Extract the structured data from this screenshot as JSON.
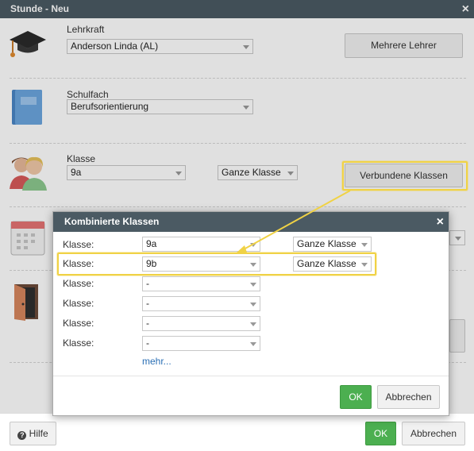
{
  "dialog": {
    "title": "Stunde - Neu",
    "close": "×",
    "teacher": {
      "label": "Lehrkraft",
      "value": "Anderson Linda (AL)",
      "button": "Mehrere Lehrer"
    },
    "subject": {
      "label": "Schulfach",
      "value": "Berufsorientierung"
    },
    "class": {
      "label": "Klasse",
      "value": "9a",
      "scope": "Ganze Klasse",
      "button": "Verbundene Klassen"
    },
    "help_button": "Hilfe",
    "ok_button": "OK",
    "cancel_button": "Abbrechen"
  },
  "modal": {
    "title": "Kombinierte Klassen",
    "close": "×",
    "rows": [
      {
        "label": "Klasse:",
        "value": "9a",
        "scope": "Ganze Klasse"
      },
      {
        "label": "Klasse:",
        "value": "9b",
        "scope": "Ganze Klasse"
      },
      {
        "label": "Klasse:",
        "value": "-"
      },
      {
        "label": "Klasse:",
        "value": "-"
      },
      {
        "label": "Klasse:",
        "value": "-"
      },
      {
        "label": "Klasse:",
        "value": "-"
      }
    ],
    "more_link": "mehr...",
    "ok_button": "OK",
    "cancel_button": "Abbrechen"
  },
  "colors": {
    "titlebar": "#4b5a63",
    "ok_green": "#4caf50",
    "highlight": "#f0d245",
    "link": "#2a6fb5"
  }
}
